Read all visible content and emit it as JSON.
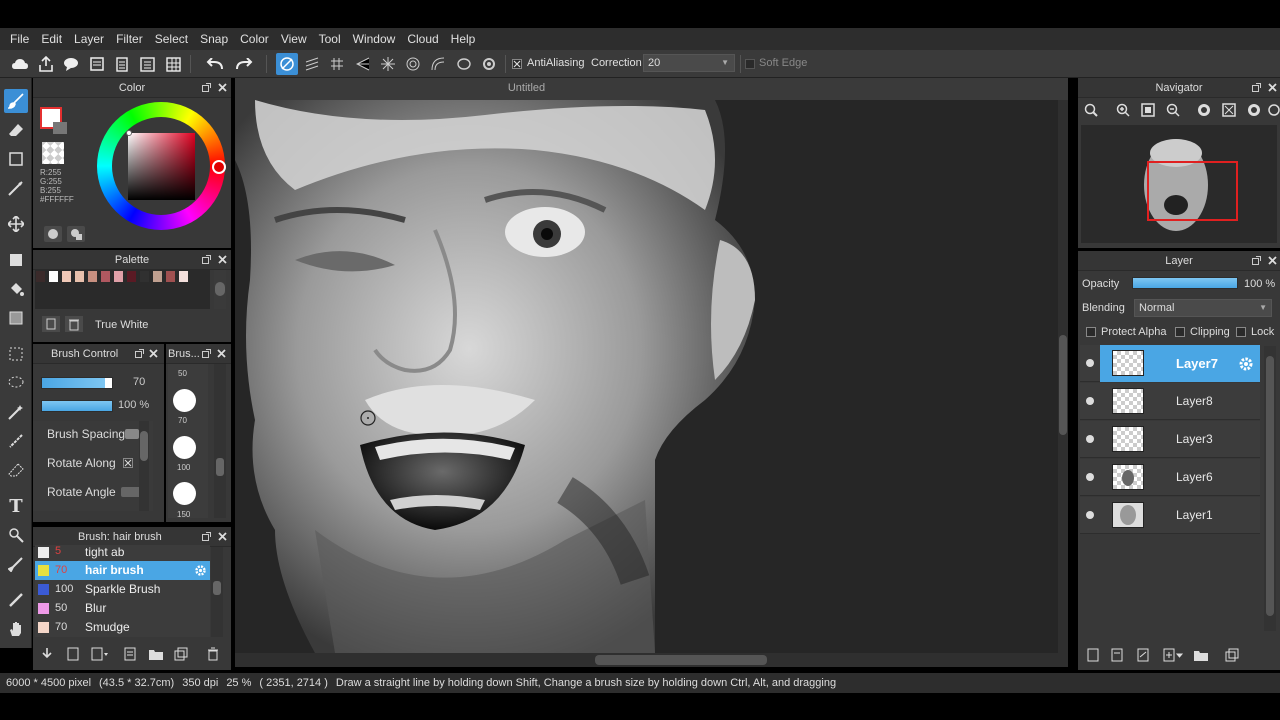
{
  "menu": [
    "File",
    "Edit",
    "Layer",
    "Filter",
    "Select",
    "Snap",
    "Color",
    "View",
    "Tool",
    "Window",
    "Cloud",
    "Help"
  ],
  "toolbar": {
    "antialiasing_label": "AntiAliasing",
    "correction_label": "Correction",
    "correction_value": "20",
    "soft_edge_label": "Soft Edge"
  },
  "document_title": "Untitled",
  "color_panel": {
    "title": "Color",
    "r": "R:255",
    "g": "G:255",
    "b": "B:255",
    "hex": "#FFFFFF",
    "fg_color": "#ffffff",
    "fg_border": "#e53030"
  },
  "palette_panel": {
    "title": "Palette",
    "swatches": [
      "#3a2a2a",
      "#ffffff",
      "#f1c9b8",
      "#e8c0ac",
      "#c89080",
      "#b05860",
      "#e0a0a8",
      "#5a1a24",
      "#303030",
      "#c0a090",
      "#a05050",
      "#f4e0dc"
    ],
    "selected_name": "True White"
  },
  "brush_control": {
    "title": "Brush Control",
    "size_value": "70",
    "opacity_value": "100 %",
    "brush_spacing": "Brush Spacing",
    "rotate_along": "Rotate Along",
    "rotate_angle": "Rotate Angle"
  },
  "brush_size_panel": {
    "title": "Brus...",
    "sizes": [
      "50",
      "70",
      "100",
      "150"
    ]
  },
  "brush_list": {
    "title": "Brush: hair brush",
    "items": [
      {
        "size": "5",
        "name": "tight ab",
        "color": "#eeeeee"
      },
      {
        "size": "70",
        "name": "hair brush",
        "color": "#e8e040"
      },
      {
        "size": "100",
        "name": "Sparkle Brush",
        "color": "#3b5bd6"
      },
      {
        "size": "50",
        "name": "Blur",
        "color": "#ef9ae8"
      },
      {
        "size": "70",
        "name": "Smudge",
        "color": "#f4d6c8"
      }
    ]
  },
  "navigator": {
    "title": "Navigator"
  },
  "layer_panel": {
    "title": "Layer",
    "opacity_label": "Opacity",
    "opacity_value": "100 %",
    "blending_label": "Blending",
    "blending_value": "Normal",
    "protect_alpha": "Protect Alpha",
    "clipping": "Clipping",
    "lock": "Lock",
    "layers": [
      "Layer7",
      "Layer8",
      "Layer3",
      "Layer6",
      "Layer1"
    ]
  },
  "status": {
    "size": "6000 * 4500 pixel",
    "physical": "(43.5 * 32.7cm)",
    "dpi": "350 dpi",
    "zoom": "25 %",
    "coords": "( 2351, 2714 )",
    "hint": "Draw a straight line by holding down Shift, Change a brush size by holding down Ctrl, Alt, and dragging"
  },
  "accent_color": "#4aa6e4"
}
